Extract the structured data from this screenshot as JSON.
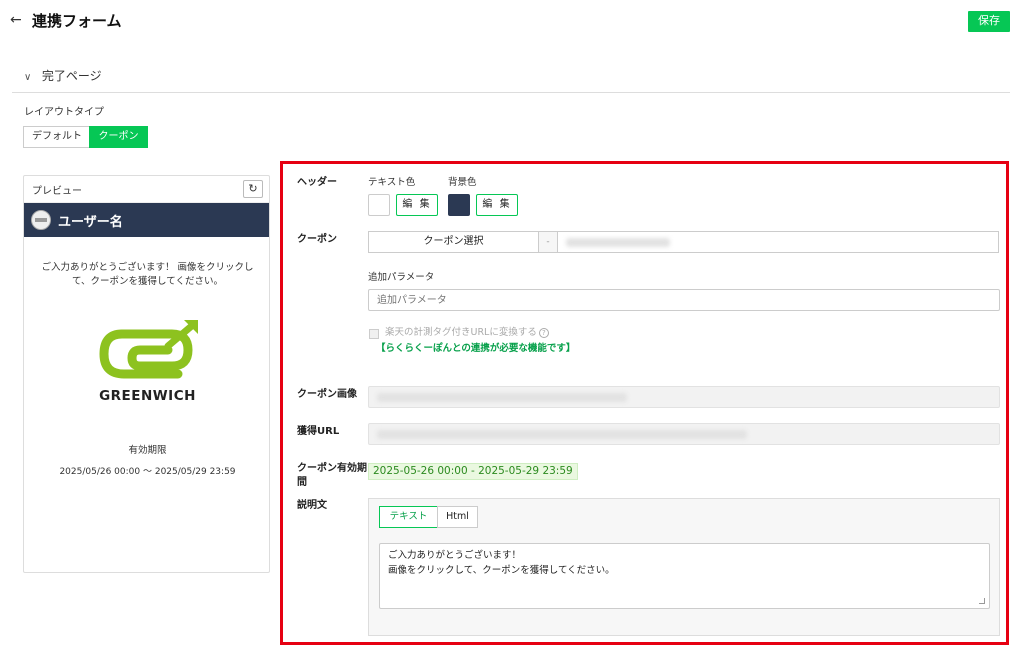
{
  "header": {
    "title": "連携フォーム",
    "save_label": "保存"
  },
  "section": {
    "title": "完了ページ"
  },
  "layout_type": {
    "label": "レイアウトタイプ",
    "options": [
      "デフォルト",
      "クーポン"
    ],
    "selected": "クーポン"
  },
  "preview": {
    "label": "プレビュー",
    "username": "ユーザー名",
    "message": "ご入力ありがとうございます！ 画像をクリックして、クーポンを獲得してください。",
    "logo_text": "GREENWICH",
    "validity_label": "有効期限",
    "validity_range": "2025/05/26 00:00 〜 2025/05/29 23:59",
    "header_color": "#2b3953"
  },
  "form": {
    "header": {
      "label": "ヘッダー",
      "text_color_label": "テキスト色",
      "bg_color_label": "背景色",
      "edit_label": "編 集",
      "text_color": "#ffffff",
      "bg_color": "#2b3953"
    },
    "coupon": {
      "label": "クーポン",
      "select_label": "クーポン選択",
      "separator": "-"
    },
    "extra_param": {
      "label": "追加パラメータ",
      "placeholder": "追加パラメータ"
    },
    "rakuten": {
      "checkbox_label": "楽天の計測タグ付きURLに変換する",
      "note": "【らくらくーぽんとの連携が必要な機能です】"
    },
    "coupon_image": {
      "label": "クーポン画像"
    },
    "acquire_url": {
      "label": "獲得URL"
    },
    "period": {
      "label_line1": "クーポン有効期",
      "label_line2": "間",
      "value": "2025-05-26 00:00 - 2025-05-29 23:59"
    },
    "description": {
      "label": "説明文",
      "tabs": [
        "テキスト",
        "Html"
      ],
      "text": "ご入力ありがとうございます！\n画像をクリックして、クーポンを獲得してください。"
    }
  },
  "colors": {
    "accent": "#06c755",
    "highlight_frame": "#e60012"
  }
}
